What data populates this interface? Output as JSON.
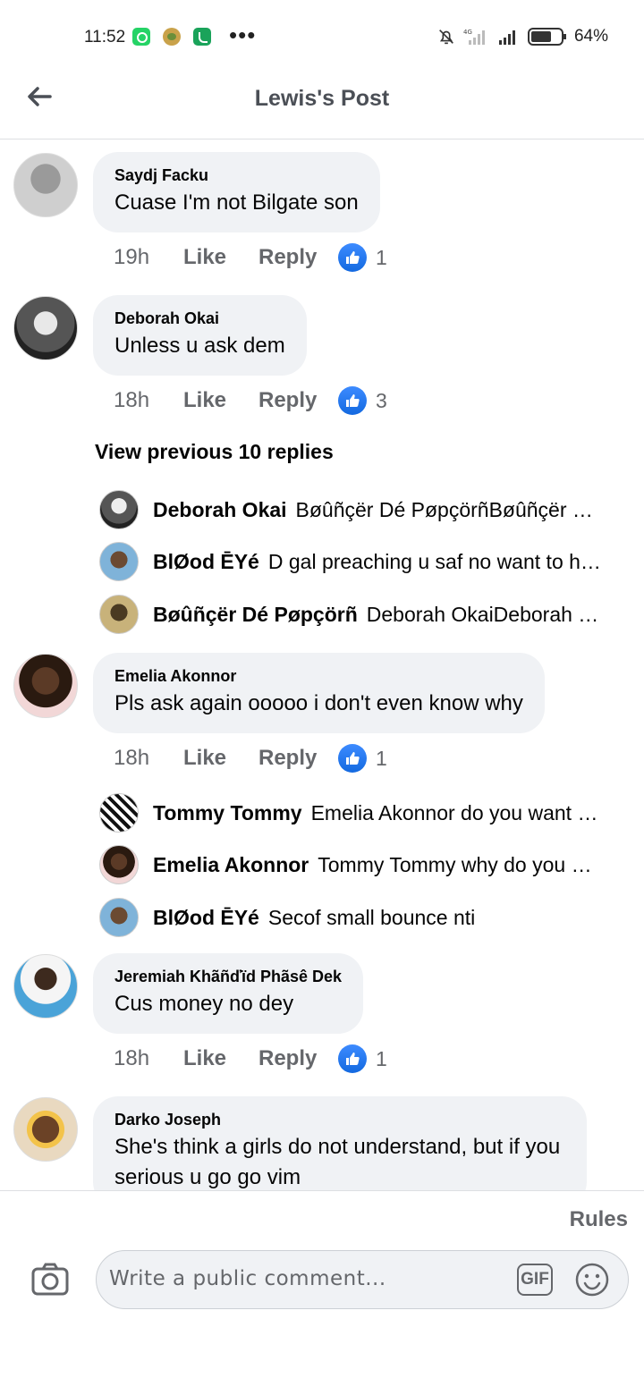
{
  "status_bar": {
    "time": "11:52",
    "battery": "64%"
  },
  "header": {
    "title": "Lewis's Post"
  },
  "comments": [
    {
      "name": "Saydj Facku",
      "text": "Cuase I'm not Bilgate son",
      "time": "19h",
      "like": "Like",
      "reply": "Reply",
      "likes": "1"
    },
    {
      "name": "Deborah Okai",
      "text": "Unless u ask dem",
      "time": "18h",
      "like": "Like",
      "reply": "Reply",
      "likes": "3"
    },
    {
      "name": "Emelia Akonnor",
      "text": "Pls ask again ooooo i don't even know why",
      "time": "18h",
      "like": "Like",
      "reply": "Reply",
      "likes": "1"
    },
    {
      "name": "Jeremiah Khãñďïd Phãsê Dek",
      "text": "Cus money no dey",
      "time": "18h",
      "like": "Like",
      "reply": "Reply",
      "likes": "1"
    },
    {
      "name": "Darko Joseph",
      "text": "She's think a girls do not understand, but if you serious u go go vim"
    }
  ],
  "view_previous": "View previous 10 replies",
  "replies_group_1": [
    {
      "name": "Deborah Okai",
      "text": "Bøûñçër Dé PøpçörñBøûñçër Dé Pøpçörñ"
    },
    {
      "name": "BlØod ĒYé",
      "text": "D gal preaching u saf no want to hear"
    },
    {
      "name": "Bøûñçër Dé Pøpçörñ",
      "text": "Deborah OkaiDeborah Okai"
    }
  ],
  "replies_group_2": [
    {
      "name": "Tommy Tommy",
      "text": "Emelia Akonnor do you want me to ask"
    },
    {
      "name": "Emelia Akonnor",
      "text": "Tommy Tommy why do you want to ask"
    },
    {
      "name": "BlØod ĒYé",
      "text": "Secof small bounce nti"
    }
  ],
  "composer": {
    "rules": "Rules",
    "placeholder": "Write a public comment...",
    "gif": "GIF"
  }
}
